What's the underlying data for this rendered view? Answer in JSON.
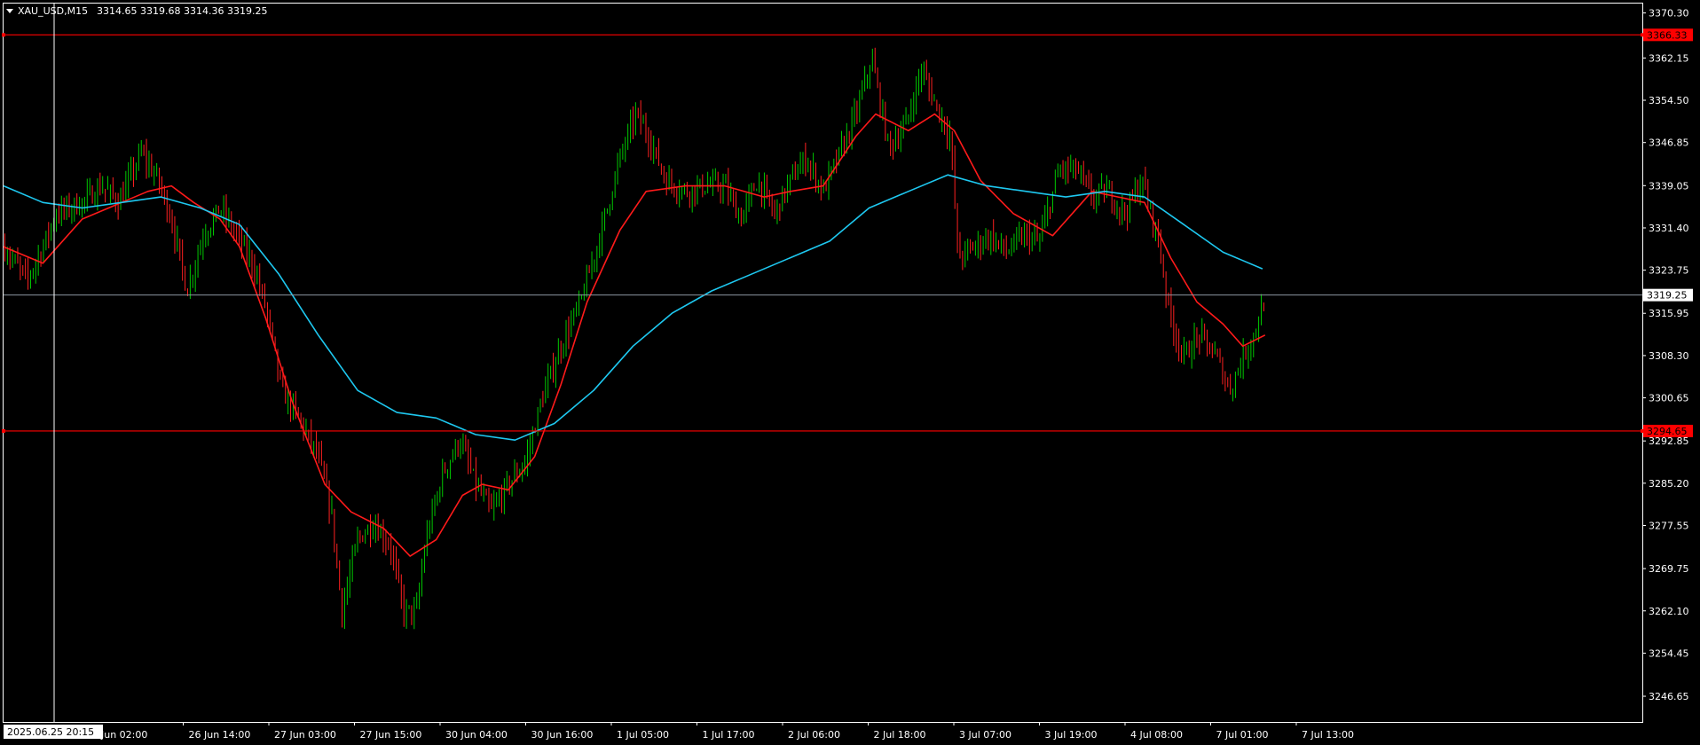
{
  "header": {
    "symbol": "XAU_USD,M15",
    "ohlc": "3314.65 3319.68 3314.36 3319.25"
  },
  "colors": {
    "background": "#000000",
    "frame": "#ffffff",
    "bull_candle": "#00c800",
    "bear_candle": "#ff2020",
    "ma_fast": "#ff1a1a",
    "ma_slow": "#1ec8f0",
    "level_line": "#ff0000",
    "price_line": "#8c96a0",
    "crosshair": "#ffffff"
  },
  "chart_data": {
    "type": "candlestick",
    "ylim": [
      3242.0,
      3372.0
    ],
    "y_ticks": [
      "3370.30",
      "3362.15",
      "3354.50",
      "3346.85",
      "3339.05",
      "3331.40",
      "3323.75",
      "3315.95",
      "3308.30",
      "3300.65",
      "3292.85",
      "3285.20",
      "3277.55",
      "3269.75",
      "3262.10",
      "3254.45",
      "3246.65"
    ],
    "x_labels": [
      "2025.06.25 20:15",
      "Jun 02:00",
      "26 Jun 14:00",
      "27 Jun 03:00",
      "27 Jun 15:00",
      "30 Jun 04:00",
      "30 Jun 16:00",
      "1 Jul 05:00",
      "1 Jul 17:00",
      "2 Jul 06:00",
      "2 Jul 18:00",
      "3 Jul 07:00",
      "3 Jul 19:00",
      "4 Jul 08:00",
      "7 Jul 01:00",
      "7 Jul 13:00"
    ],
    "levels": [
      {
        "value": 3366.33,
        "label": "3366.33"
      },
      {
        "value": 3294.65,
        "label": "3294.65"
      }
    ],
    "current_price": {
      "value": 3319.25,
      "label": "3319.25"
    },
    "price_path": [
      {
        "t": 0.0,
        "p": 3328
      },
      {
        "t": 0.018,
        "p": 3322
      },
      {
        "t": 0.03,
        "p": 3328
      },
      {
        "t": 0.04,
        "p": 3334
      },
      {
        "t": 0.06,
        "p": 3336
      },
      {
        "t": 0.075,
        "p": 3339
      },
      {
        "t": 0.088,
        "p": 3336
      },
      {
        "t": 0.105,
        "p": 3345
      },
      {
        "t": 0.118,
        "p": 3340
      },
      {
        "t": 0.128,
        "p": 3333
      },
      {
        "t": 0.14,
        "p": 3320
      },
      {
        "t": 0.152,
        "p": 3330
      },
      {
        "t": 0.165,
        "p": 3335
      },
      {
        "t": 0.178,
        "p": 3330
      },
      {
        "t": 0.19,
        "p": 3325
      },
      {
        "t": 0.2,
        "p": 3317
      },
      {
        "t": 0.212,
        "p": 3302
      },
      {
        "t": 0.225,
        "p": 3297
      },
      {
        "t": 0.24,
        "p": 3290
      },
      {
        "t": 0.25,
        "p": 3280
      },
      {
        "t": 0.258,
        "p": 3262
      },
      {
        "t": 0.27,
        "p": 3275
      },
      {
        "t": 0.282,
        "p": 3278
      },
      {
        "t": 0.295,
        "p": 3274
      },
      {
        "t": 0.305,
        "p": 3262
      },
      {
        "t": 0.315,
        "p": 3262
      },
      {
        "t": 0.322,
        "p": 3275
      },
      {
        "t": 0.335,
        "p": 3287
      },
      {
        "t": 0.348,
        "p": 3293
      },
      {
        "t": 0.36,
        "p": 3285
      },
      {
        "t": 0.372,
        "p": 3280
      },
      {
        "t": 0.385,
        "p": 3285
      },
      {
        "t": 0.398,
        "p": 3289
      },
      {
        "t": 0.41,
        "p": 3300
      },
      {
        "t": 0.425,
        "p": 3310
      },
      {
        "t": 0.44,
        "p": 3318
      },
      {
        "t": 0.455,
        "p": 3330
      },
      {
        "t": 0.47,
        "p": 3344
      },
      {
        "t": 0.482,
        "p": 3352
      },
      {
        "t": 0.492,
        "p": 3348
      },
      {
        "t": 0.505,
        "p": 3340
      },
      {
        "t": 0.52,
        "p": 3338
      },
      {
        "t": 0.535,
        "p": 3339
      },
      {
        "t": 0.55,
        "p": 3339
      },
      {
        "t": 0.562,
        "p": 3333
      },
      {
        "t": 0.575,
        "p": 3340
      },
      {
        "t": 0.588,
        "p": 3334
      },
      {
        "t": 0.6,
        "p": 3340
      },
      {
        "t": 0.612,
        "p": 3344
      },
      {
        "t": 0.625,
        "p": 3338
      },
      {
        "t": 0.638,
        "p": 3345
      },
      {
        "t": 0.65,
        "p": 3352
      },
      {
        "t": 0.662,
        "p": 3362
      },
      {
        "t": 0.675,
        "p": 3346
      },
      {
        "t": 0.688,
        "p": 3350
      },
      {
        "t": 0.7,
        "p": 3360
      },
      {
        "t": 0.712,
        "p": 3353
      },
      {
        "t": 0.722,
        "p": 3348
      },
      {
        "t": 0.728,
        "p": 3326
      },
      {
        "t": 0.74,
        "p": 3328
      },
      {
        "t": 0.752,
        "p": 3330
      },
      {
        "t": 0.765,
        "p": 3327
      },
      {
        "t": 0.778,
        "p": 3330
      },
      {
        "t": 0.79,
        "p": 3329
      },
      {
        "t": 0.805,
        "p": 3342
      },
      {
        "t": 0.818,
        "p": 3342
      },
      {
        "t": 0.83,
        "p": 3337
      },
      {
        "t": 0.842,
        "p": 3338
      },
      {
        "t": 0.855,
        "p": 3334
      },
      {
        "t": 0.868,
        "p": 3340
      },
      {
        "t": 0.88,
        "p": 3330
      },
      {
        "t": 0.89,
        "p": 3315
      },
      {
        "t": 0.9,
        "p": 3308
      },
      {
        "t": 0.912,
        "p": 3312
      },
      {
        "t": 0.925,
        "p": 3308
      },
      {
        "t": 0.935,
        "p": 3302
      },
      {
        "t": 0.945,
        "p": 3308
      },
      {
        "t": 0.955,
        "p": 3313
      },
      {
        "t": 0.962,
        "p": 3319
      }
    ],
    "series": [
      {
        "name": "",
        "type": "line",
        "color_key": "ma_fast",
        "values": [
          {
            "t": 0.0,
            "p": 3328
          },
          {
            "t": 0.03,
            "p": 3325
          },
          {
            "t": 0.06,
            "p": 3333
          },
          {
            "t": 0.09,
            "p": 3336
          },
          {
            "t": 0.11,
            "p": 3338
          },
          {
            "t": 0.128,
            "p": 3339
          },
          {
            "t": 0.145,
            "p": 3336
          },
          {
            "t": 0.165,
            "p": 3333
          },
          {
            "t": 0.18,
            "p": 3328
          },
          {
            "t": 0.2,
            "p": 3315
          },
          {
            "t": 0.22,
            "p": 3300
          },
          {
            "t": 0.245,
            "p": 3285
          },
          {
            "t": 0.265,
            "p": 3280
          },
          {
            "t": 0.29,
            "p": 3277
          },
          {
            "t": 0.31,
            "p": 3272
          },
          {
            "t": 0.33,
            "p": 3275
          },
          {
            "t": 0.35,
            "p": 3283
          },
          {
            "t": 0.365,
            "p": 3285
          },
          {
            "t": 0.385,
            "p": 3284
          },
          {
            "t": 0.405,
            "p": 3290
          },
          {
            "t": 0.425,
            "p": 3303
          },
          {
            "t": 0.445,
            "p": 3318
          },
          {
            "t": 0.47,
            "p": 3331
          },
          {
            "t": 0.49,
            "p": 3338
          },
          {
            "t": 0.52,
            "p": 3339
          },
          {
            "t": 0.55,
            "p": 3339
          },
          {
            "t": 0.58,
            "p": 3337
          },
          {
            "t": 0.6,
            "p": 3338
          },
          {
            "t": 0.625,
            "p": 3339
          },
          {
            "t": 0.65,
            "p": 3348
          },
          {
            "t": 0.665,
            "p": 3352
          },
          {
            "t": 0.69,
            "p": 3349
          },
          {
            "t": 0.71,
            "p": 3352
          },
          {
            "t": 0.725,
            "p": 3349
          },
          {
            "t": 0.745,
            "p": 3340
          },
          {
            "t": 0.77,
            "p": 3334
          },
          {
            "t": 0.8,
            "p": 3330
          },
          {
            "t": 0.83,
            "p": 3338
          },
          {
            "t": 0.85,
            "p": 3337
          },
          {
            "t": 0.87,
            "p": 3336
          },
          {
            "t": 0.89,
            "p": 3326
          },
          {
            "t": 0.91,
            "p": 3318
          },
          {
            "t": 0.93,
            "p": 3314
          },
          {
            "t": 0.945,
            "p": 3310
          },
          {
            "t": 0.962,
            "p": 3312
          }
        ]
      },
      {
        "name": "",
        "type": "line",
        "color_key": "ma_slow",
        "values": [
          {
            "t": 0.0,
            "p": 3339
          },
          {
            "t": 0.03,
            "p": 3336
          },
          {
            "t": 0.06,
            "p": 3335
          },
          {
            "t": 0.09,
            "p": 3336
          },
          {
            "t": 0.12,
            "p": 3337
          },
          {
            "t": 0.15,
            "p": 3335
          },
          {
            "t": 0.18,
            "p": 3332
          },
          {
            "t": 0.21,
            "p": 3323
          },
          {
            "t": 0.24,
            "p": 3312
          },
          {
            "t": 0.27,
            "p": 3302
          },
          {
            "t": 0.3,
            "p": 3298
          },
          {
            "t": 0.33,
            "p": 3297
          },
          {
            "t": 0.36,
            "p": 3294
          },
          {
            "t": 0.39,
            "p": 3293
          },
          {
            "t": 0.42,
            "p": 3296
          },
          {
            "t": 0.45,
            "p": 3302
          },
          {
            "t": 0.48,
            "p": 3310
          },
          {
            "t": 0.51,
            "p": 3316
          },
          {
            "t": 0.54,
            "p": 3320
          },
          {
            "t": 0.57,
            "p": 3323
          },
          {
            "t": 0.6,
            "p": 3326
          },
          {
            "t": 0.63,
            "p": 3329
          },
          {
            "t": 0.66,
            "p": 3335
          },
          {
            "t": 0.69,
            "p": 3338
          },
          {
            "t": 0.72,
            "p": 3341
          },
          {
            "t": 0.75,
            "p": 3339
          },
          {
            "t": 0.78,
            "p": 3338
          },
          {
            "t": 0.81,
            "p": 3337
          },
          {
            "t": 0.84,
            "p": 3338
          },
          {
            "t": 0.87,
            "p": 3337
          },
          {
            "t": 0.9,
            "p": 3332
          },
          {
            "t": 0.93,
            "p": 3327
          },
          {
            "t": 0.96,
            "p": 3324
          }
        ]
      }
    ]
  }
}
